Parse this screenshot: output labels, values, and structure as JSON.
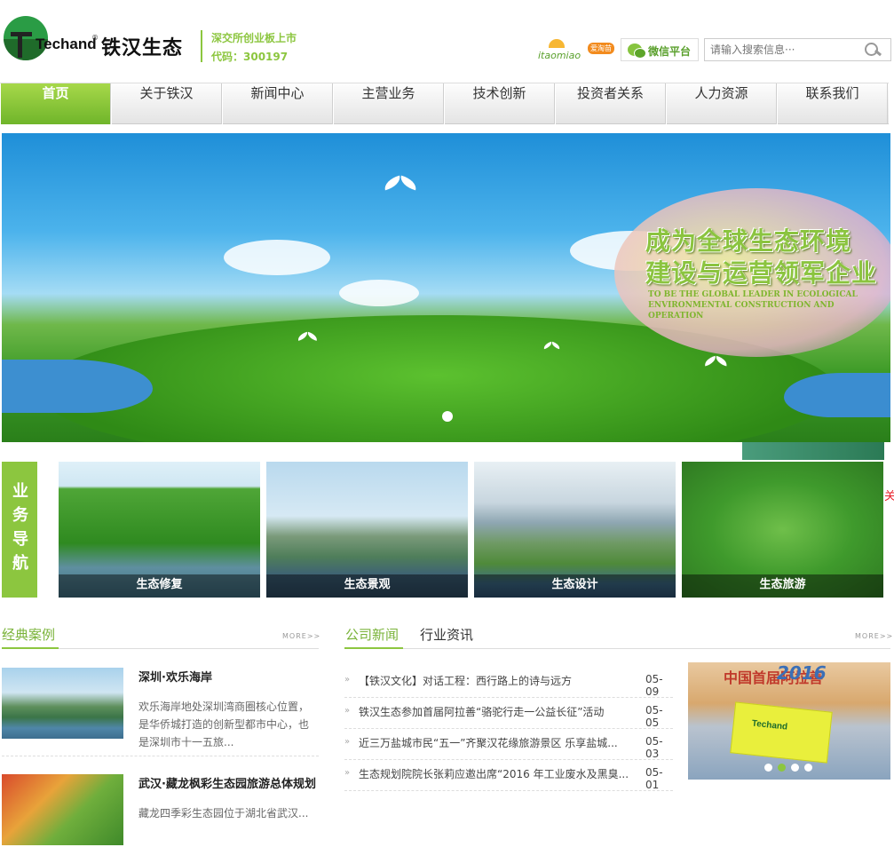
{
  "header": {
    "logo_en": "Techand",
    "logo_reg": "®",
    "logo_cn": "铁汉生态",
    "stock_line1": "深交所创业板上市",
    "stock_line2": "代码：300197",
    "itaomiao_label": "itaomiao",
    "itaomiao_badge": "爱淘苗",
    "wechat_label": "微信平台",
    "search_placeholder": "请输入搜索信息···"
  },
  "nav": {
    "items": [
      {
        "label": "首页",
        "active": true
      },
      {
        "label": "关于铁汉"
      },
      {
        "label": "新闻中心"
      },
      {
        "label": "主营业务"
      },
      {
        "label": "技术创新"
      },
      {
        "label": "投资者关系"
      },
      {
        "label": "人力资源"
      },
      {
        "label": "联系我们"
      }
    ]
  },
  "banner": {
    "slogan_line1": "成为全球生态环境",
    "slogan_line2": "建设与运营领军企业",
    "slogan_en": "To be the global leader in ecological environmental construction and operation"
  },
  "business": {
    "label": "业务导航",
    "cards": [
      {
        "caption": "生态修复"
      },
      {
        "caption": "生态景观"
      },
      {
        "caption": "生态设计"
      },
      {
        "caption": "生态旅游"
      }
    ],
    "close_text": "关"
  },
  "cases": {
    "title": "经典案例",
    "more": "MORE>>",
    "items": [
      {
        "title": "深圳·欢乐海岸",
        "desc": "欢乐海岸地处深圳湾商圈核心位置，是华侨城打造的创新型都市中心，也是深圳市十一五旅..."
      },
      {
        "title": "武汉·藏龙枫彩生态园旅游总体规划",
        "desc": "藏龙四季彩生态园位于湖北省武汉..."
      }
    ]
  },
  "news": {
    "tab_company": "公司新闻",
    "tab_industry": "行业资讯",
    "more": "MORE>>",
    "items": [
      {
        "title": "【铁汉文化】对话工程：西行路上的诗与远方",
        "date": "05-09"
      },
      {
        "title": "铁汉生态参加首届阿拉善“骆驼行走一公益长征”活动",
        "date": "05-05"
      },
      {
        "title": "近三万盐城市民“五一”齐聚汉花缘旅游景区 乐享盐城...",
        "date": "05-03"
      },
      {
        "title": "生态规划院院长张莉应邀出席“2016 年工业废水及黑臭...",
        "date": "05-01"
      }
    ],
    "photo_banner_text": "中国首届阿拉善",
    "photo_year": "2016",
    "photo_flag": "Techand"
  },
  "colors": {
    "brand_green": "#8cc63f",
    "nav_active": "#7ab52d"
  }
}
